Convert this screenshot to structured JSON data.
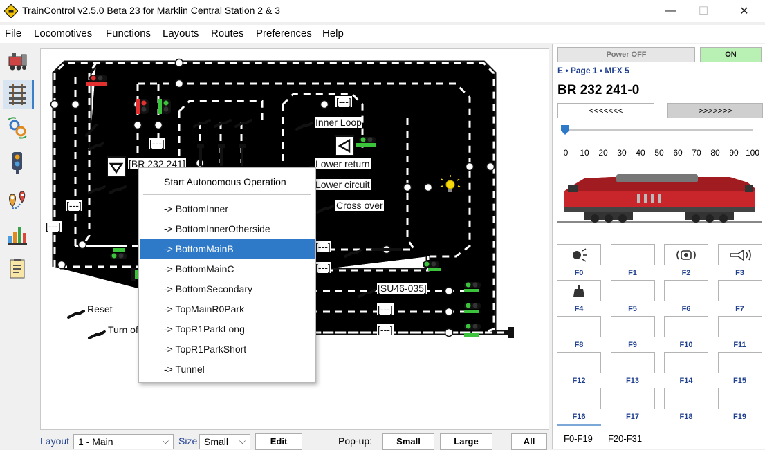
{
  "window": {
    "title": "TrainControl v2.5.0 Beta 23 for Marklin Central Station 2 & 3",
    "controls": [
      "—",
      "☐",
      "✕"
    ]
  },
  "menu": [
    "File",
    "Locomotives",
    "Functions",
    "Layouts",
    "Routes",
    "Preferences",
    "Help"
  ],
  "sidebar": [
    {
      "icon": "locomotive-icon"
    },
    {
      "icon": "track-layout-icon",
      "active": true
    },
    {
      "icon": "gear-automation-icon"
    },
    {
      "icon": "signal-icon"
    },
    {
      "icon": "map-pin-icon"
    },
    {
      "icon": "statistics-chart-icon"
    },
    {
      "icon": "log-document-icon"
    }
  ],
  "layout": {
    "labels": {
      "br232": "[BR 232 241]",
      "dash1": "[---]",
      "dash2": "[---]",
      "dash3": "[---]",
      "dash4": "[---]",
      "dash5": "[---]",
      "dash6": "[---]",
      "dash7": "[---]",
      "dash8": "[---]",
      "dash9": "[---]",
      "su46": "[SU46-035]",
      "inner_loop": "Inner Loop",
      "lower_return": "Lower return",
      "lower_circuit": "Lower circuit",
      "cross_over": "Cross over",
      "reset": "Reset",
      "turn_off": "Turn of"
    }
  },
  "context_menu": {
    "header": "Start Autonomous Operation",
    "items": [
      "-> BottomInner",
      "-> BottomInnerOtherside",
      "-> BottomMainB",
      "-> BottomMainC",
      "-> BottomSecondary",
      "-> TopMainR0Park",
      "-> TopR1ParkLong",
      "-> TopR1ParkShort",
      "-> Tunnel"
    ],
    "selected": "-> BottomMainB"
  },
  "bottom_bar": {
    "layout_label": "Layout",
    "layout_value": "1 - Main",
    "size_label": "Size",
    "size_value": "Small",
    "edit": "Edit",
    "popup_label": "Pop-up:",
    "small": "Small",
    "large": "Large",
    "all": "All"
  },
  "loco_panel": {
    "power_off": "Power OFF",
    "on": "ON",
    "info": "E • Page 1 • MFX 5",
    "name": "BR 232 241-0",
    "reverse": "<<<<<<<",
    "forward": ">>>>>>>",
    "speed": 0,
    "speed_ticks": [
      "0",
      "10",
      "20",
      "30",
      "40",
      "50",
      "60",
      "70",
      "80",
      "90",
      "100"
    ],
    "colors": {
      "on_bg": "#b9f0b4",
      "accent": "#2f7ac8",
      "label": "#1f3f8f"
    },
    "functions": [
      {
        "label": "F0",
        "icon": "light-icon"
      },
      {
        "label": "F1",
        "icon": ""
      },
      {
        "label": "F2",
        "icon": "sound-icon"
      },
      {
        "label": "F3",
        "icon": "horn-icon"
      },
      {
        "label": "F4",
        "icon": "weight-icon"
      },
      {
        "label": "F5",
        "icon": ""
      },
      {
        "label": "F6",
        "icon": ""
      },
      {
        "label": "F7",
        "icon": ""
      },
      {
        "label": "F8",
        "icon": ""
      },
      {
        "label": "F9",
        "icon": ""
      },
      {
        "label": "F10",
        "icon": ""
      },
      {
        "label": "F11",
        "icon": ""
      },
      {
        "label": "F12",
        "icon": ""
      },
      {
        "label": "F13",
        "icon": ""
      },
      {
        "label": "F14",
        "icon": ""
      },
      {
        "label": "F15",
        "icon": ""
      },
      {
        "label": "F16",
        "icon": ""
      },
      {
        "label": "F17",
        "icon": ""
      },
      {
        "label": "F18",
        "icon": ""
      },
      {
        "label": "F19",
        "icon": ""
      }
    ],
    "tabs": [
      "F0-F19",
      "F20-F31"
    ]
  }
}
